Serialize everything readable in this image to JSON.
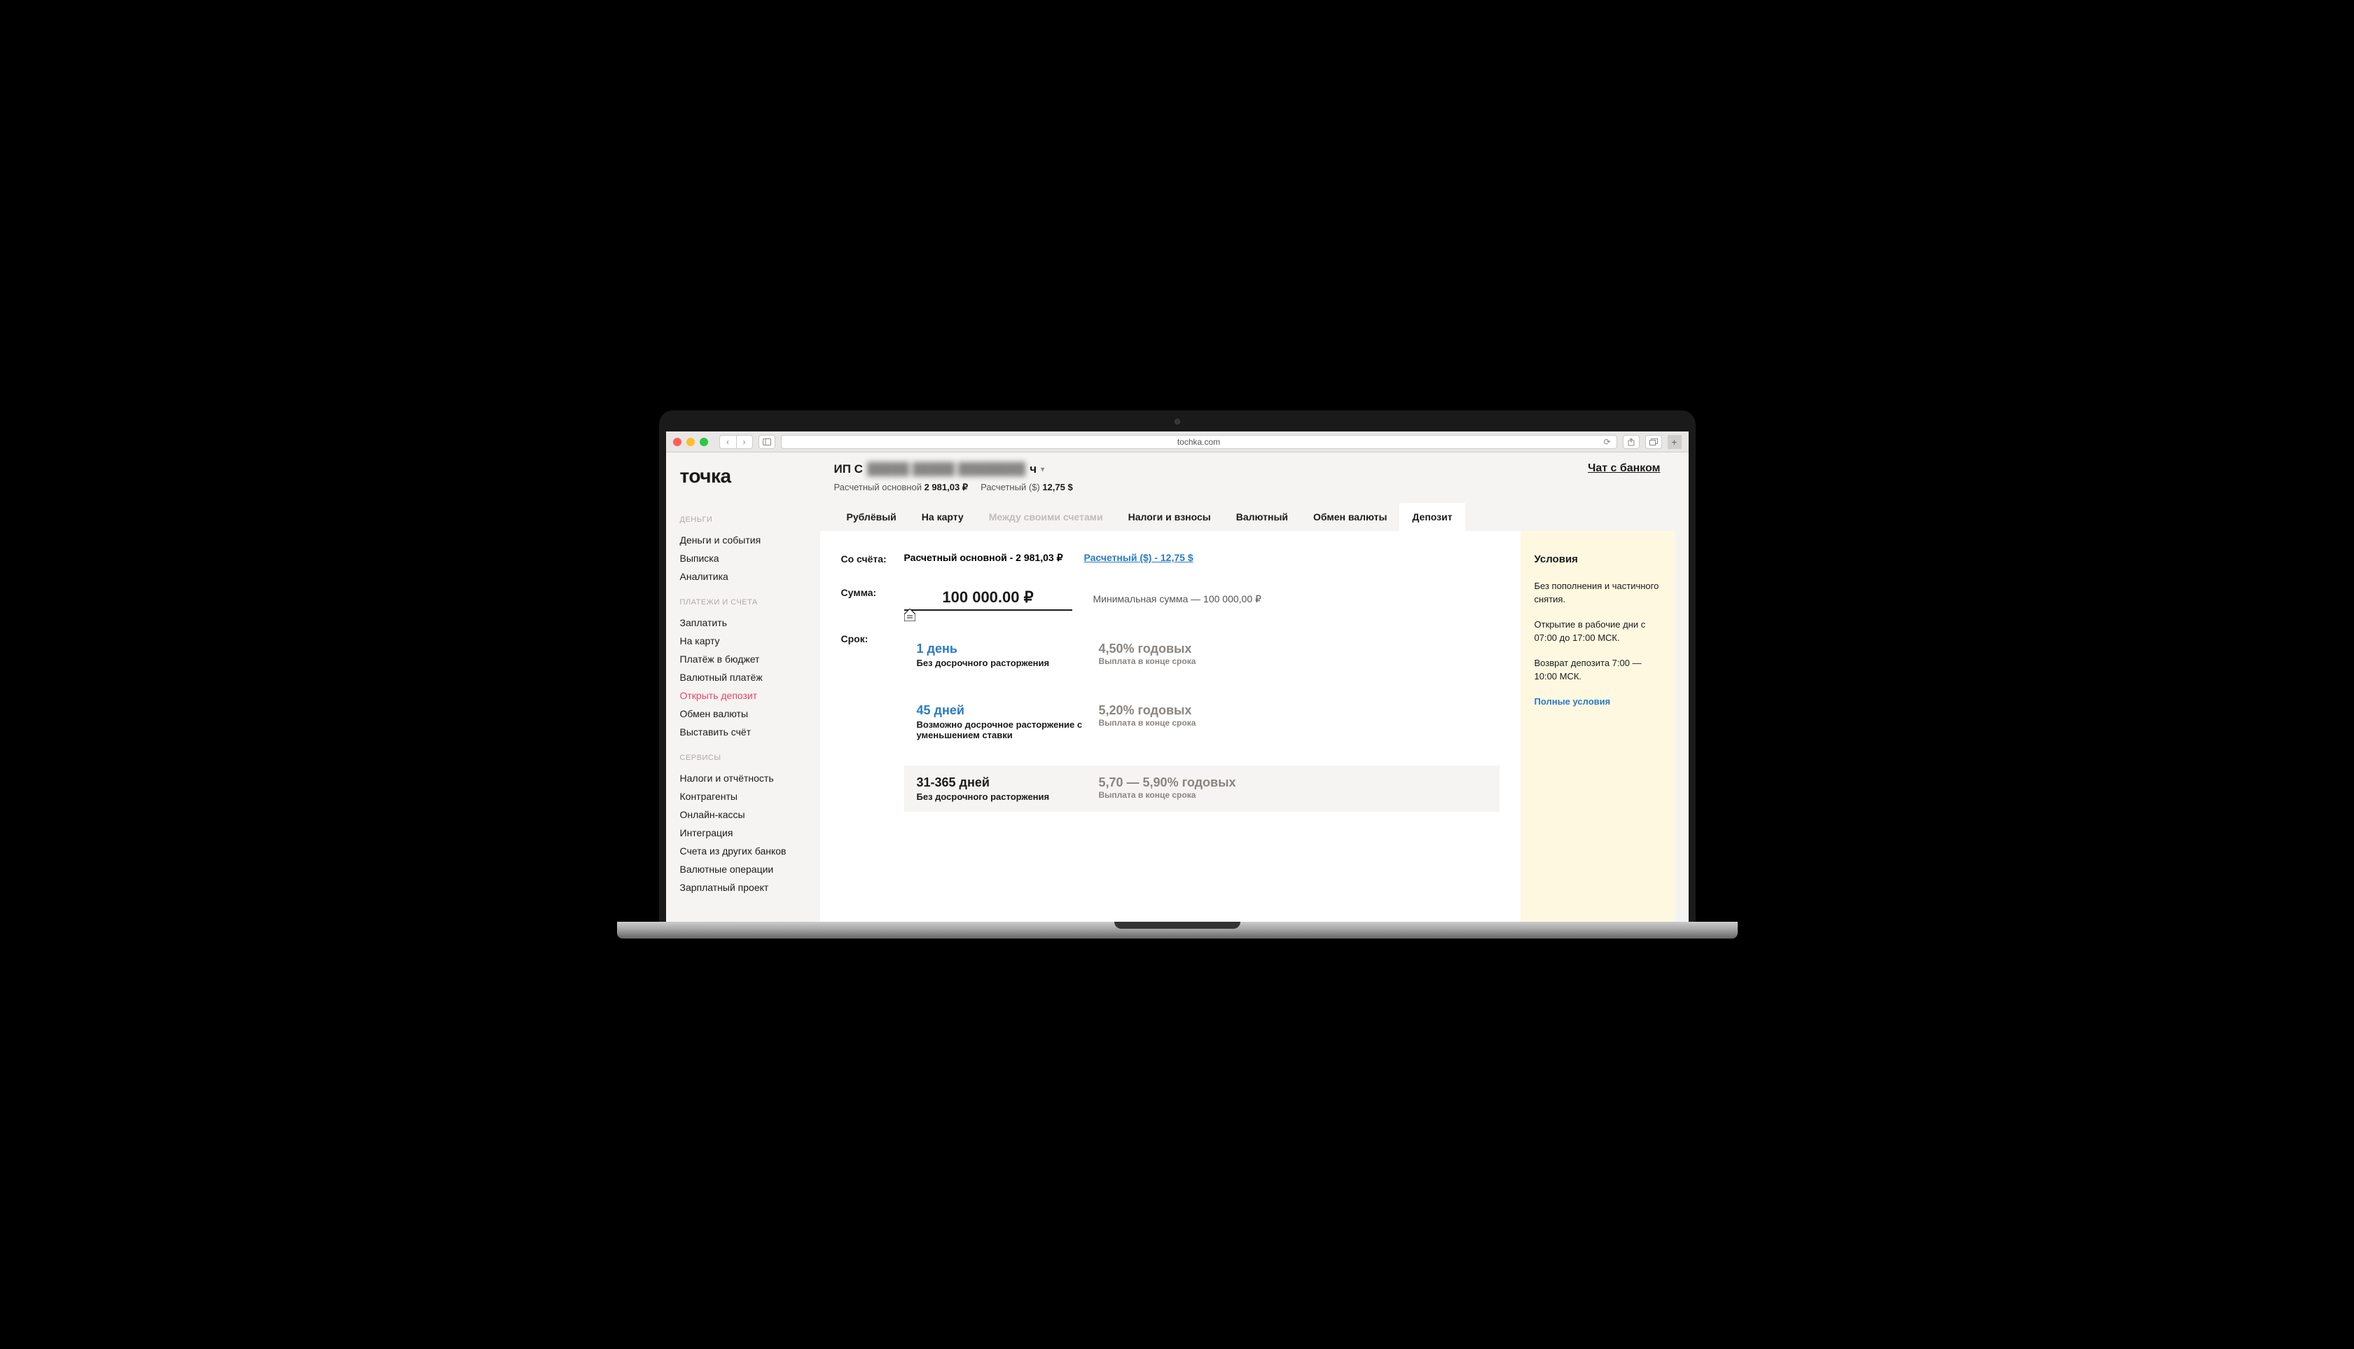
{
  "browser": {
    "url": "tochka.com"
  },
  "logo": "точка",
  "sidebar": {
    "sections": [
      {
        "title": "ДЕНЬГИ",
        "items": [
          "Деньги и события",
          "Выписка",
          "Аналитика"
        ]
      },
      {
        "title": "ПЛАТЕЖИ И СЧЕТА",
        "items": [
          "Заплатить",
          "На карту",
          "Платёж в бюджет",
          "Валютный платёж",
          "Открыть депозит",
          "Обмен валюты",
          "Выставить счёт"
        ]
      },
      {
        "title": "СЕРВИСЫ",
        "items": [
          "Налоги и отчётность",
          "Контрагенты",
          "Онлайн-кассы",
          "Интеграция",
          "Счета из других банков",
          "Валютные операции",
          "Зарплатный проект"
        ]
      }
    ],
    "active": "Открыть депозит"
  },
  "header": {
    "company_prefix": "ИП С",
    "company_blur": "█████ █████ ████████",
    "company_suffix": "ч",
    "balances": [
      {
        "label": "Расчетный основной",
        "amount": "2 981,03 ₽"
      },
      {
        "label": "Расчетный ($)",
        "amount": "12,75 $"
      }
    ],
    "chat": "Чат с банком"
  },
  "tabs": {
    "items": [
      {
        "label": "Рублёвый",
        "state": "normal"
      },
      {
        "label": "На карту",
        "state": "normal"
      },
      {
        "label": "Между своими счетами",
        "state": "disabled"
      },
      {
        "label": "Налоги и взносы",
        "state": "normal"
      },
      {
        "label": "Валютный",
        "state": "normal"
      },
      {
        "label": "Обмен валюты",
        "state": "normal"
      },
      {
        "label": "Депозит",
        "state": "active"
      }
    ]
  },
  "form": {
    "from_label": "Со счёта:",
    "from_options": [
      {
        "text": "Расчетный основной - 2 981,03 ₽",
        "link": false
      },
      {
        "text": "Расчетный ($) - 12,75 $",
        "link": true
      }
    ],
    "amount_label": "Сумма:",
    "amount_value": "100 000.00 ₽",
    "min_amount": "Минимальная сумма — 100 000,00 ₽",
    "term_label": "Срок:",
    "terms": [
      {
        "title": "1 день",
        "sub": "Без досрочного расторжения",
        "rate": "4,50% годовых",
        "rate_sub": "Выплата в конце срока",
        "boxed": false
      },
      {
        "title": "45 дней",
        "sub": "Возможно досрочное расторжение с уменьшением ставки",
        "rate": "5,20% годовых",
        "rate_sub": "Выплата в конце срока",
        "boxed": false
      },
      {
        "title": "31-365 дней",
        "sub": "Без досрочного расторжения",
        "rate": "5,70 — 5,90% годовых",
        "rate_sub": "Выплата в конце срока",
        "boxed": true
      }
    ]
  },
  "conditions": {
    "title": "Условия",
    "p1": "Без пополнения и частичного снятия.",
    "p2": "Открытие в рабочие дни с 07:00 до 17:00 МСК.",
    "p3": "Возврат депозита 7:00 — 10:00 МСК.",
    "link": "Полные условия"
  }
}
